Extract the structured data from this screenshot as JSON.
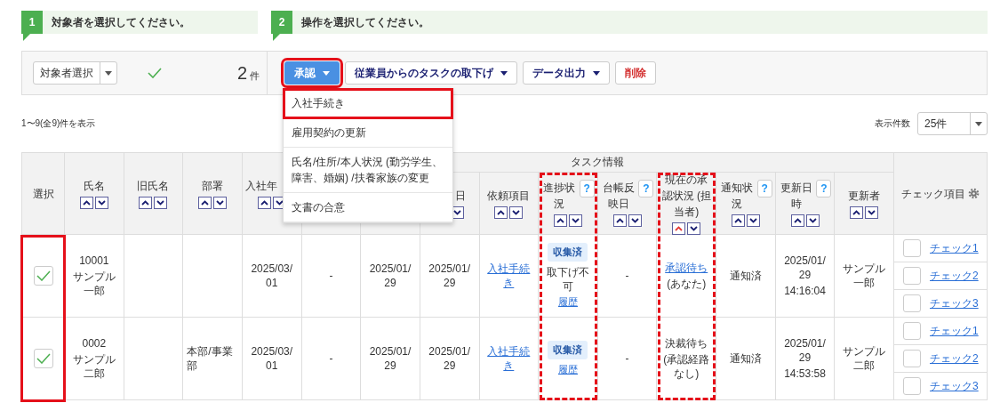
{
  "steps": [
    {
      "number": "1",
      "label": "対象者を選択してください。"
    },
    {
      "number": "2",
      "label": "操作を選択してください。"
    }
  ],
  "toolbar": {
    "target_select": {
      "value": "対象者選択"
    },
    "all_checked": true,
    "count": "2",
    "count_unit": "件",
    "actions": [
      {
        "label": "承認",
        "kind": "primary",
        "dropdown": true,
        "highlighted": true,
        "expanded": true
      },
      {
        "label": "従業員からのタスクの取下げ",
        "kind": "default",
        "dropdown": true,
        "highlighted": false
      },
      {
        "label": "データ出力",
        "kind": "default",
        "dropdown": true,
        "highlighted": false
      },
      {
        "label": "削除",
        "kind": "danger",
        "dropdown": false,
        "highlighted": false
      }
    ],
    "menu": [
      {
        "label": "入社手続き",
        "highlighted": true
      },
      {
        "label": "雇用契約の更新",
        "highlighted": false
      },
      {
        "label": "氏名/住所/本人状況 (勤労学生、障害、婚姻) /扶養家族の変更",
        "highlighted": false
      },
      {
        "label": "文書の合意",
        "highlighted": false
      }
    ]
  },
  "summary": "1〜9(全9)件を表示",
  "page_size": {
    "label": "表示件数",
    "value": "25件"
  },
  "table": {
    "group_header": "タスク情報",
    "columns": [
      {
        "kind": "select",
        "label": "選択",
        "framed": true,
        "frame_dashed": false
      },
      {
        "kind": "name",
        "label": "氏名",
        "sort_asc": false
      },
      {
        "kind": "text",
        "label": "旧氏名",
        "sort_asc": false
      },
      {
        "kind": "text",
        "label": "部署",
        "sort_asc": false
      },
      {
        "kind": "date",
        "label": "入社年",
        "sort_asc": false
      },
      {
        "kind": "text"
      },
      {
        "kind": "date"
      },
      {
        "kind": "date",
        "label": "日",
        "sortable": true
      },
      {
        "kind": "link",
        "label": "依頼項目",
        "sort_asc": false
      },
      {
        "kind": "progress",
        "label": "進捗状況",
        "help": "?",
        "sort_asc": false,
        "framed": true,
        "frame_dashed": true
      },
      {
        "kind": "text",
        "label": "台帳反映日",
        "help": "?",
        "sort_asc": false
      },
      {
        "kind": "status",
        "label": "現在の承認状況 (担当者)",
        "sort_asc": true,
        "framed": true,
        "frame_dashed": true
      },
      {
        "kind": "text",
        "label": "通知状況",
        "help": "?",
        "sort_asc": false
      },
      {
        "kind": "datetime",
        "label": "更新日時",
        "help": "?",
        "sort_asc": false
      },
      {
        "kind": "text",
        "label": "更新者",
        "sort_asc": false
      },
      {
        "kind": "checks",
        "label": "チェック項目",
        "settings": true
      }
    ],
    "rows": [
      {
        "cells": [
          {
            "checked": true
          },
          {
            "id": "10001",
            "name": "サンプル一郎"
          },
          null,
          null,
          {
            "text": "2025/03/01"
          },
          {
            "text": "-"
          },
          {
            "text": "2025/01/29"
          },
          {
            "text": "2025/01/29"
          },
          {
            "text": "入社手続き"
          },
          {
            "badge": "収集済",
            "note": "取下げ不可",
            "link": "履歴"
          },
          {
            "text": "-"
          },
          {
            "status": "承認待ち",
            "status_link": true,
            "detail": "(あなた)"
          },
          {
            "text": "通知済"
          },
          {
            "date": "2025/01/29",
            "time": "14:16:04"
          },
          {
            "text": "サンプル一郎"
          }
        ],
        "checks": [
          {
            "label": "チェック1",
            "checked": false
          },
          {
            "label": "チェック2",
            "checked": false
          },
          {
            "label": "チェック3",
            "checked": false
          }
        ]
      },
      {
        "cells": [
          {
            "checked": true
          },
          {
            "id": "0002",
            "name": "サンプル二郎"
          },
          null,
          {
            "text": "本部/事業部"
          },
          {
            "text": "2025/03/01"
          },
          {
            "text": "-"
          },
          {
            "text": "2025/01/29"
          },
          {
            "text": "2025/01/29"
          },
          {
            "text": "入社手続き"
          },
          {
            "badge": "収集済",
            "link": "履歴"
          },
          {
            "text": "-"
          },
          {
            "status": "決裁待ち",
            "status_link": false,
            "detail": "(承認経路なし)"
          },
          {
            "text": "通知済"
          },
          {
            "date": "2025/01/29",
            "time": "14:53:58"
          },
          {
            "text": "サンプル二郎"
          }
        ],
        "checks": [
          {
            "label": "チェック1",
            "checked": false
          },
          {
            "label": "チェック2",
            "checked": false
          },
          {
            "label": "チェック3",
            "checked": false
          }
        ]
      }
    ]
  }
}
